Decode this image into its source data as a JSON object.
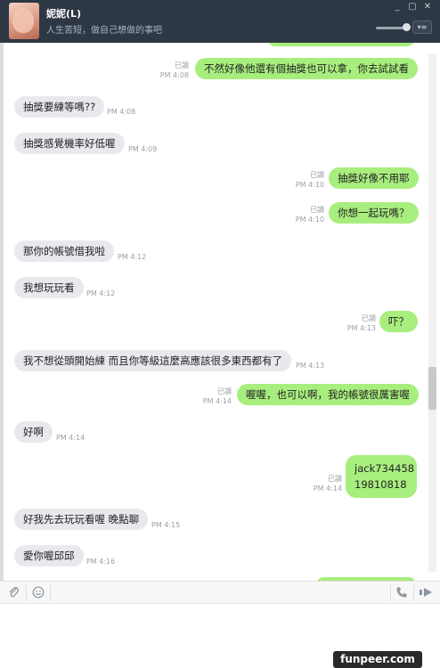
{
  "header": {
    "contact_name": "妮妮(L)",
    "status_message": "人生苦短，做自己想做的事吧",
    "window_buttons": [
      "_",
      "▢",
      "✕"
    ],
    "menu_label": "▾≡"
  },
  "messages": [
    {
      "dir": "out",
      "text": "不然好像他還有個抽獎也可以拿，你去試試看",
      "read": "已讀",
      "time": "PM 4:08"
    },
    {
      "dir": "in",
      "text": "抽獎要練等嗎??",
      "time": "PM 4:08"
    },
    {
      "dir": "in",
      "text": "抽獎感覺機率好低喔",
      "time": "PM 4:09"
    },
    {
      "dir": "out",
      "text": "抽獎好像不用耶",
      "read": "已讀",
      "time": "PM 4:10"
    },
    {
      "dir": "out",
      "text": "你想一起玩嗎？",
      "read": "已讀",
      "time": "PM 4:10"
    },
    {
      "dir": "in",
      "text": "那你的帳號借我啦",
      "time": "PM 4:12"
    },
    {
      "dir": "in",
      "text": "我想玩玩看",
      "time": "PM 4:12"
    },
    {
      "dir": "out",
      "text": "吓？",
      "read": "已讀",
      "time": "PM 4:13"
    },
    {
      "dir": "in",
      "text": "我不想從頭開始練 而且你等級這麼高應該很多東西都有了",
      "time": "PM 4:13"
    },
    {
      "dir": "out",
      "text": "喔喔，也可以啊，我的帳號很厲害喔",
      "read": "已讀",
      "time": "PM 4:14"
    },
    {
      "dir": "in",
      "text": "好啊",
      "time": "PM 4:14"
    },
    {
      "dir": "out",
      "line1": "jack734458",
      "line2": "19810818",
      "read": "已讀",
      "time": "PM 4:14"
    },
    {
      "dir": "in",
      "text": "好我先去玩玩看喔 晚點聊",
      "time": "PM 4:15"
    },
    {
      "dir": "in",
      "text": "愛你喔邱邱",
      "time": "PM 4:16"
    }
  ],
  "toolbar": {
    "attach_icon": "paperclip-icon",
    "emoji_icon": "smiley-icon",
    "call_icon": "phone-icon",
    "send_icon": "send-icon"
  },
  "watermark": "funpeer.com",
  "colors": {
    "header_bg": "#2e3744",
    "outgoing_bubble": "#a8ee7e",
    "incoming_bubble": "#e7e9ed"
  }
}
